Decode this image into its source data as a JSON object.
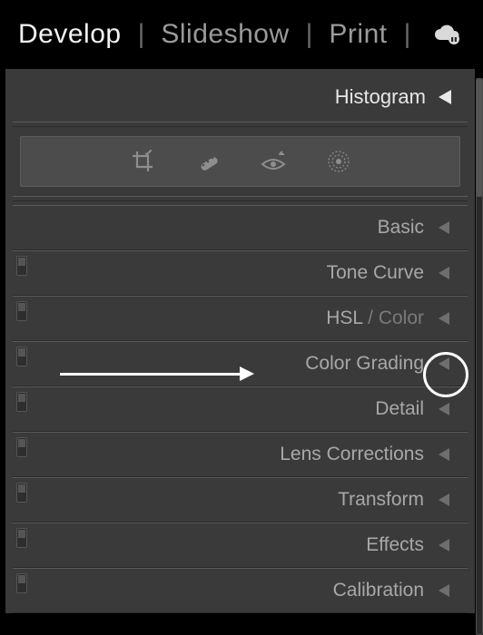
{
  "modules": {
    "develop": "Develop",
    "slideshow": "Slideshow",
    "print": "Print"
  },
  "histogram": {
    "label": "Histogram"
  },
  "panels": {
    "basic": {
      "label": "Basic",
      "has_switch": false
    },
    "toneCurve": {
      "label": "Tone Curve",
      "has_switch": true
    },
    "hslColor": {
      "label_main": "HSL",
      "label_sep": " / ",
      "label_alt": "Color",
      "has_switch": true
    },
    "colorGrading": {
      "label": "Color Grading",
      "has_switch": true
    },
    "detail": {
      "label": "Detail",
      "has_switch": true
    },
    "lensCorr": {
      "label": "Lens Corrections",
      "has_switch": true
    },
    "transform": {
      "label": "Transform",
      "has_switch": true
    },
    "effects": {
      "label": "Effects",
      "has_switch": true
    },
    "calibration": {
      "label": "Calibration",
      "has_switch": true
    }
  }
}
